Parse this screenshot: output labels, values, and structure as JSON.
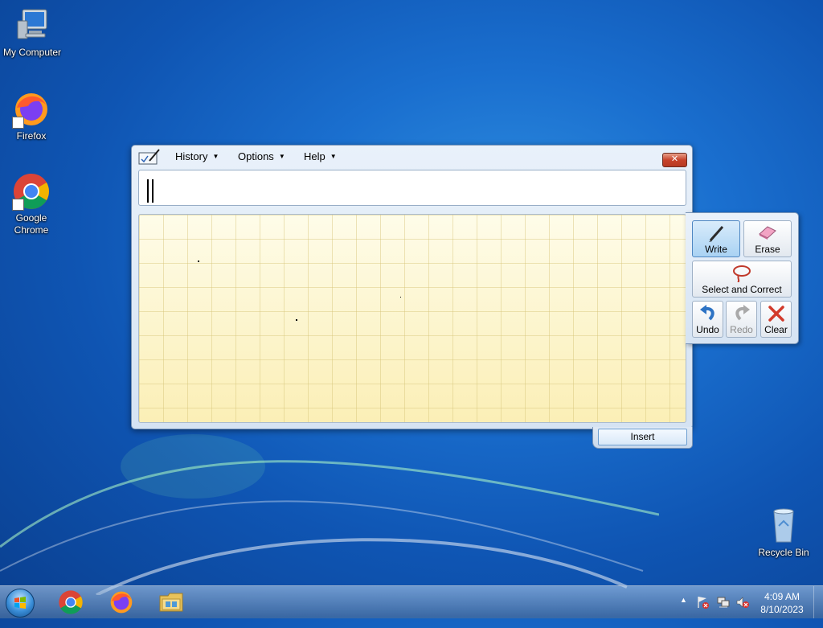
{
  "desktop": {
    "icons": [
      {
        "label": "My Computer"
      },
      {
        "label": "Firefox"
      },
      {
        "label": "Google Chrome"
      },
      {
        "label": "Recycle Bin"
      }
    ]
  },
  "tip": {
    "menu": {
      "history": "History",
      "options": "Options",
      "help": "Help"
    },
    "close_label": "✕",
    "insert_label": "Insert",
    "tools": {
      "write": "Write",
      "erase": "Erase",
      "select_correct": "Select and Correct",
      "undo": "Undo",
      "redo": "Redo",
      "clear": "Clear"
    }
  },
  "taskbar": {
    "time": "4:09 AM",
    "date": "8/10/2023"
  },
  "colors": {
    "pad_background": "#fdf6cf",
    "close_red": "#c7432b",
    "desktop_blue": "#1a6fcf"
  }
}
